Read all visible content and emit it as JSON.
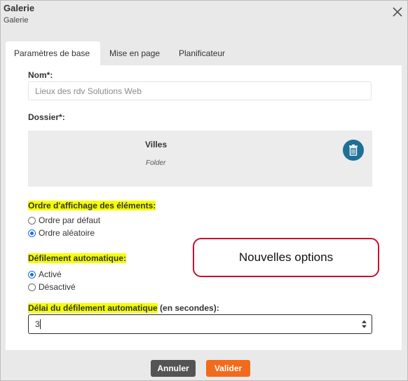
{
  "dialog": {
    "title": "Galerie",
    "subtitle": "Galerie"
  },
  "tabs": [
    {
      "label": "Paramètres de base",
      "active": true
    },
    {
      "label": "Mise en page",
      "active": false
    },
    {
      "label": "Planificateur",
      "active": false
    }
  ],
  "form": {
    "name": {
      "label": "Nom*:",
      "value": "Lieux des rdv Solutions Web"
    },
    "folder": {
      "label": "Dossier*:",
      "name": "Villes",
      "type": "Folder"
    },
    "display_order": {
      "label": "Ordre d'affichage des éléments:",
      "options": [
        {
          "label": "Ordre par défaut",
          "checked": false
        },
        {
          "label": "Ordre aléatoire",
          "checked": true
        }
      ]
    },
    "autoscroll": {
      "label": "Défilement automatique:",
      "options": [
        {
          "label": "Activé",
          "checked": true
        },
        {
          "label": "Désactivé",
          "checked": false
        }
      ]
    },
    "delay": {
      "label_highlighted": "Délai du défilement automatique",
      "label_rest": " (en secondes):",
      "value": "3"
    }
  },
  "callout": {
    "text": "Nouvelles options"
  },
  "footer": {
    "cancel_label": "Annuler",
    "ok_label": "Valider"
  },
  "colors": {
    "highlight": "#f5ff00",
    "primary_button": "#f26a1b",
    "secondary_button": "#545454",
    "delete_button": "#1f6f97",
    "callout_border": "#c8102e",
    "radio_checked": "#1d6fd6"
  },
  "icons": {
    "close": "close-icon",
    "delete": "trash-icon",
    "spinner": "spinner-arrows-icon"
  }
}
